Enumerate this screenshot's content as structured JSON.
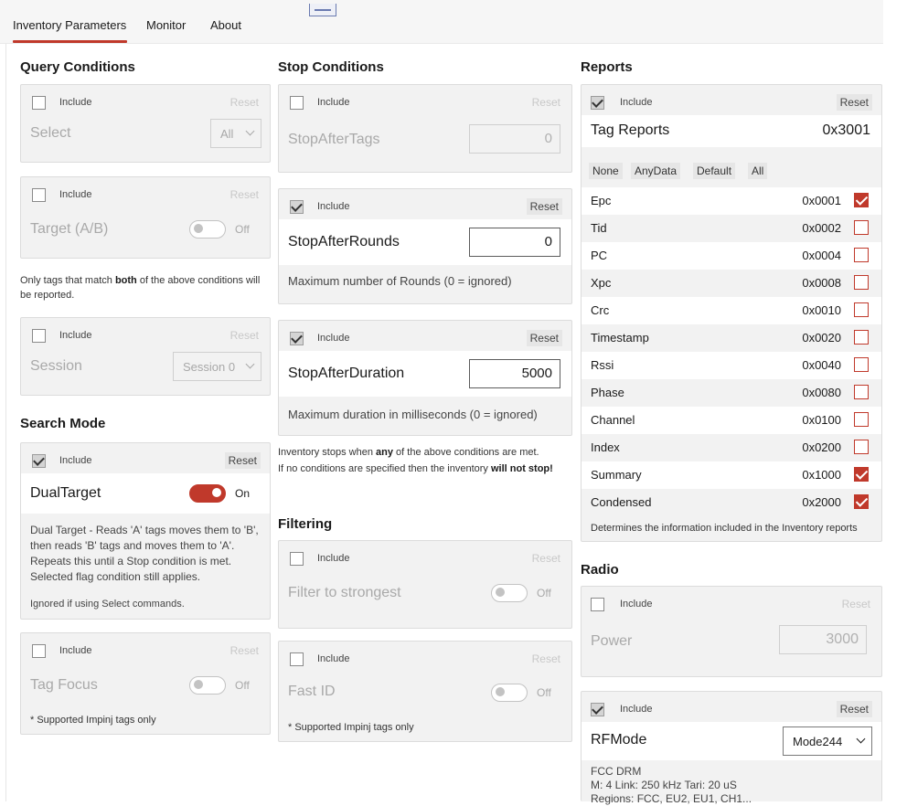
{
  "tabs": [
    {
      "label": "Inventory Parameters"
    },
    {
      "label": "Monitor"
    },
    {
      "label": "About"
    }
  ],
  "common": {
    "include": "Include",
    "reset": "Reset",
    "off": "Off",
    "on": "On"
  },
  "query": {
    "title": "Query Conditions",
    "select_label": "Select",
    "select_value": "All",
    "target_label": "Target (A/B)",
    "note_pre": "Only tags that match ",
    "note_bold": "both",
    "note_post": " of the above conditions will be reported.",
    "session_label": "Session",
    "session_value": "Session 0"
  },
  "search": {
    "title": "Search Mode",
    "dual_label": "DualTarget",
    "dual_desc": "Dual Target - Reads 'A' tags moves them to 'B', then reads 'B' tags and moves them to 'A'. Repeats this until a Stop condition is met. Selected flag condition still applies.",
    "dual_note": "Ignored if using Select commands.",
    "focus_label": "Tag Focus",
    "focus_note": "* Supported Impinj tags only"
  },
  "stop": {
    "title": "Stop Conditions",
    "tags_label": "StopAfterTags",
    "tags_value": "0",
    "rounds_label": "StopAfterRounds",
    "rounds_value": "0",
    "rounds_desc": "Maximum number of Rounds (0 = ignored)",
    "duration_label": "StopAfterDuration",
    "duration_value": "5000",
    "duration_desc": "Maximum duration in milliseconds (0 = ignored)",
    "note1_pre": "Inventory stops when ",
    "note1_bold": "any",
    "note1_post": " of the above conditions are met.",
    "note2_pre": "If no conditions are specified then the inventory ",
    "note2_bold": "will not stop!"
  },
  "filtering": {
    "title": "Filtering",
    "strongest_label": "Filter to strongest",
    "fastid_label": "Fast ID",
    "fastid_note": "* Supported Impinj tags only"
  },
  "reports": {
    "title": "Reports",
    "tag_reports_label": "Tag Reports",
    "tag_reports_value": "0x3001",
    "presets": [
      "None",
      "AnyData",
      "Default",
      "All"
    ],
    "items": [
      {
        "name": "Epc",
        "code": "0x0001",
        "checked": true
      },
      {
        "name": "Tid",
        "code": "0x0002",
        "checked": false
      },
      {
        "name": "PC",
        "code": "0x0004",
        "checked": false
      },
      {
        "name": "Xpc",
        "code": "0x0008",
        "checked": false
      },
      {
        "name": "Crc",
        "code": "0x0010",
        "checked": false
      },
      {
        "name": "Timestamp",
        "code": "0x0020",
        "checked": false
      },
      {
        "name": "Rssi",
        "code": "0x0040",
        "checked": false
      },
      {
        "name": "Phase",
        "code": "0x0080",
        "checked": false
      },
      {
        "name": "Channel",
        "code": "0x0100",
        "checked": false
      },
      {
        "name": "Index",
        "code": "0x0200",
        "checked": false
      },
      {
        "name": "Summary",
        "code": "0x1000",
        "checked": true
      },
      {
        "name": "Condensed",
        "code": "0x2000",
        "checked": true
      }
    ],
    "note": "Determines the information included in the Inventory reports"
  },
  "radio": {
    "title": "Radio",
    "power_label": "Power",
    "power_value": "3000",
    "rfmode_label": "RFMode",
    "rfmode_value": "Mode244",
    "mode_line1": "FCC DRM",
    "mode_line2": "M: 4  Link: 250 kHz  Tari: 20 uS",
    "mode_line3": "Regions: FCC, EU2, EU1, CH1..."
  },
  "colors": {
    "accent": "#c0392b",
    "card_bg": "#f2f2f2"
  }
}
